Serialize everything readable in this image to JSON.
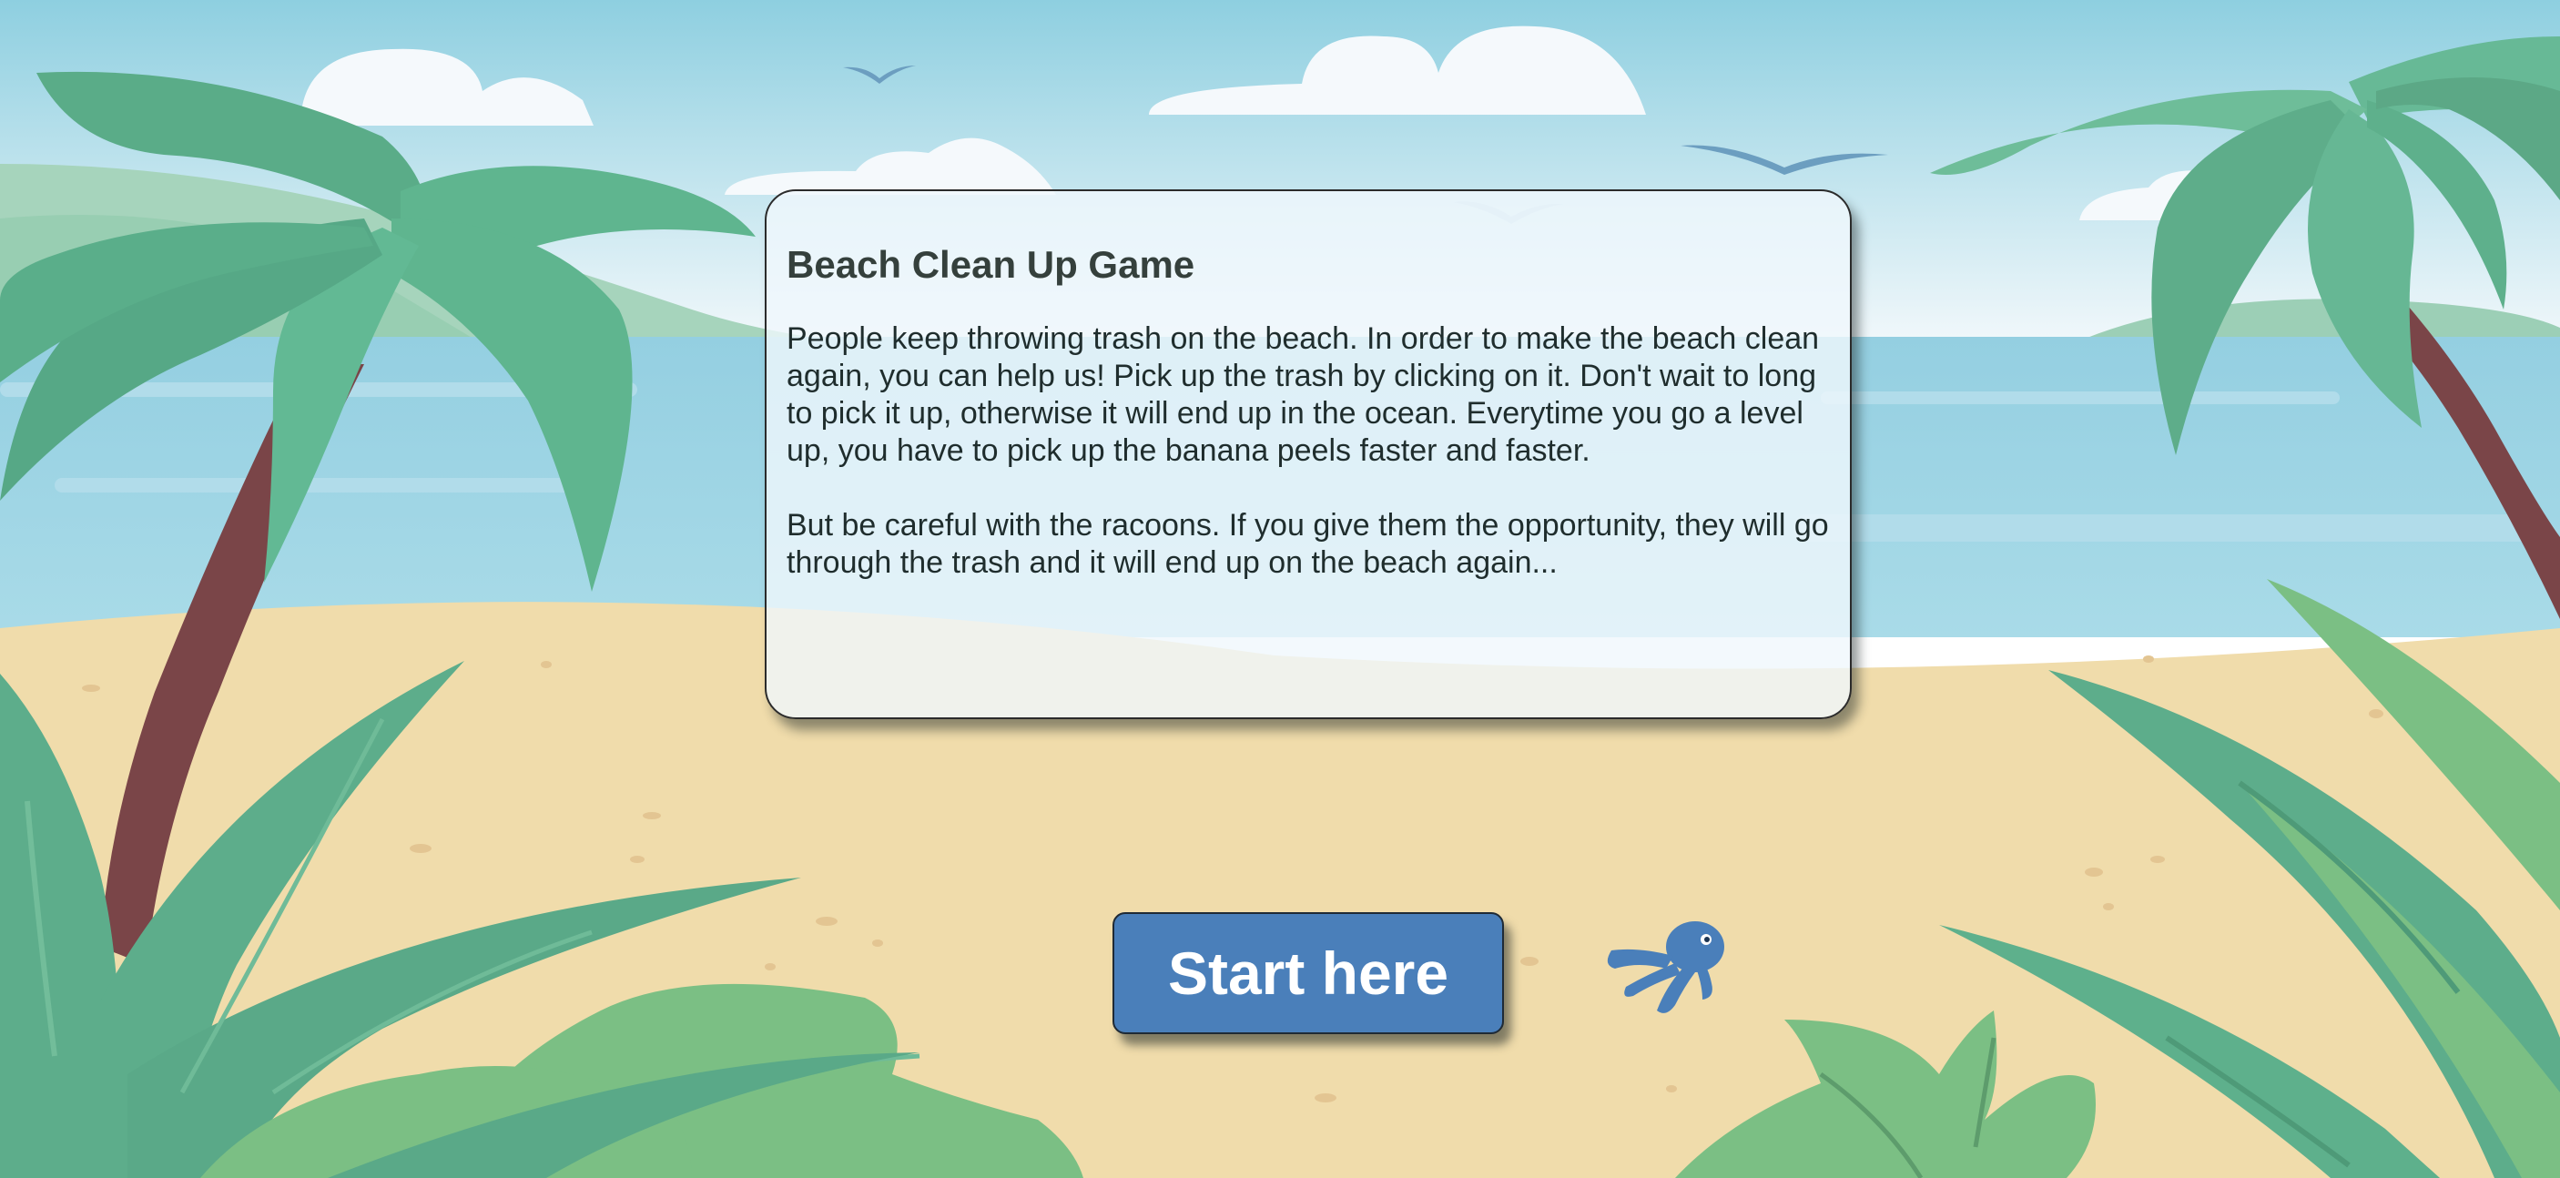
{
  "game": {
    "title": "Beach Clean Up Game",
    "paragraphs": [
      "People keep throwing trash on the beach. In order to make the beach clean again, you can help us! Pick up the trash by clicking on it. Don't wait to long to pick it up, otherwise it will end up in the ocean. Everytime you go a level up, you have to pick up the banana peels faster and faster.",
      "But be careful with the racoons. If you give them the opportunity, they will go through the trash and it will end up on the beach again..."
    ],
    "start_label": "Start here"
  },
  "colors": {
    "sky": "#8ecfe0",
    "sea": "#9ad3e3",
    "sand": "#f0dcab",
    "palm_leaf": "#5cb38e",
    "palm_trunk": "#7a4548",
    "button": "#4a7fba",
    "octopus": "#4a7fba"
  },
  "icons": [
    "cloud-icon",
    "bird-icon",
    "palm-tree-icon",
    "octopus-icon"
  ]
}
